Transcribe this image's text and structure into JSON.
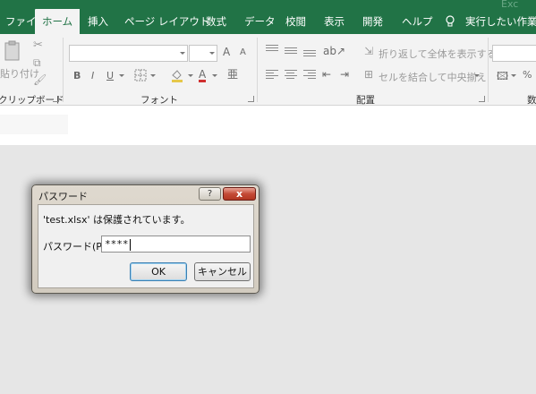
{
  "title_bar": {
    "app_ghost": "Exc"
  },
  "tabs": [
    {
      "label": "ファイル",
      "active": false
    },
    {
      "label": "ホーム",
      "active": true
    },
    {
      "label": "挿入",
      "active": false
    },
    {
      "label": "ページ レイアウト",
      "active": false
    },
    {
      "label": "数式",
      "active": false
    },
    {
      "label": "データ",
      "active": false
    },
    {
      "label": "校閲",
      "active": false
    },
    {
      "label": "表示",
      "active": false
    },
    {
      "label": "開発",
      "active": false
    },
    {
      "label": "ヘルプ",
      "active": false
    }
  ],
  "tell_me": {
    "label": "実行したい作業を入"
  },
  "ribbon": {
    "clipboard": {
      "label": "クリップボード",
      "paste_label": "貼り付け"
    },
    "font": {
      "label": "フォント",
      "bold": "B",
      "italic": "I",
      "underline": "U",
      "grow": "A",
      "shrink": "A",
      "font_color": "A"
    },
    "alignment": {
      "label": "配置",
      "wrap_text": "折り返して全体を表示する",
      "merge_center": "セルを結合して中央揃え"
    },
    "number": {
      "label": "数",
      "percent": "%"
    }
  },
  "dialog": {
    "title": "パスワード",
    "help": "?",
    "close": "x",
    "message": "'test.xlsx' は保護されています。",
    "password_label": "パスワード(P):",
    "password_value": "****",
    "ok": "OK",
    "cancel": "キャンセル"
  },
  "colors": {
    "accent": "#217346",
    "ribbon_bg": "#f3f3f3",
    "workspace": "#e6e6e6"
  }
}
